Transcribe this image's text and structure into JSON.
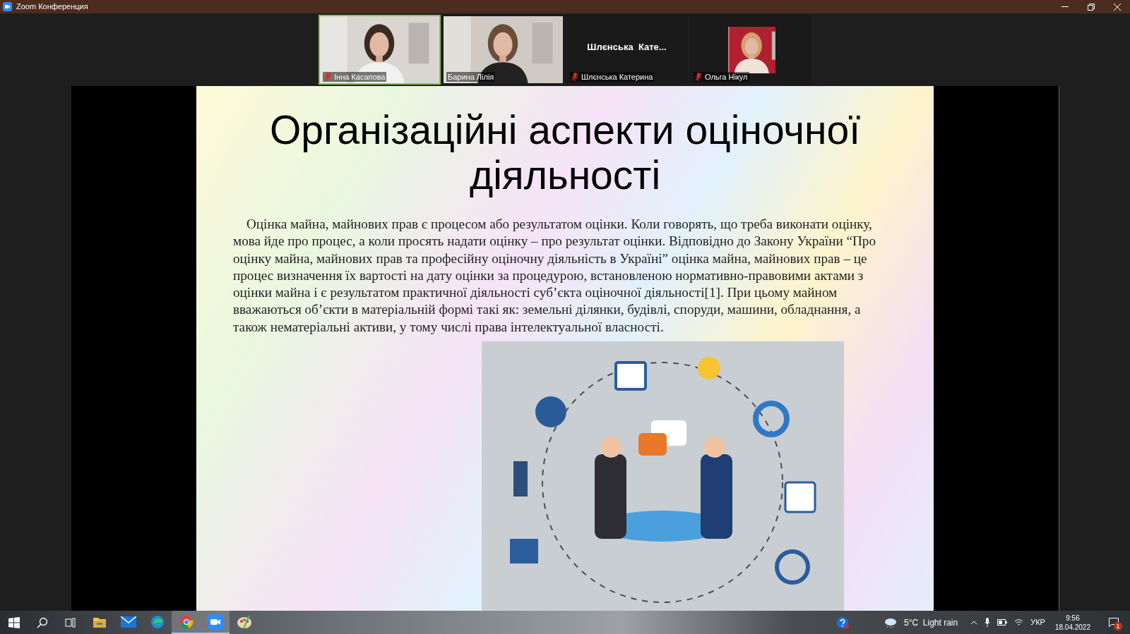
{
  "window": {
    "title": "Zoom Конференция"
  },
  "participants": [
    {
      "name": "Інна Касапова",
      "kind": "video",
      "muted": true,
      "selected": true
    },
    {
      "name": "Барина Лілія",
      "kind": "video",
      "muted": false,
      "selected": false
    },
    {
      "name": "Шлєнська Катерина",
      "kind": "name",
      "display": "Шлєнська  Кате...",
      "muted": true,
      "selected": false
    },
    {
      "name": "Ольга Нікул",
      "muted": true,
      "selected": false
    }
  ],
  "slide": {
    "title": "Організаційні аспекти оціночної діяльності",
    "body": "Оцінка майна, майнових прав є процесом або результатом оцінки. Коли говорять, що треба виконати оцінку, мова йде про процес, а коли просять надати оцінку – про результат оцінки. Відповідно до Закону України “Про оцінку майна, майнових прав та професійну оціночну діяльність в Україні” оцінка майна, майнових прав – це процес визначення їх вартості на дату оцінки за процедурою, встановленою нормативно-правовими актами з оцінки майна і є результатом практичної діяльності суб’єкта оціночної діяльності[1]. При цьому майном вважаються об’єкти в матеріальній формі такі як: земельні ділянки, будівлі, споруди, машини, обладнання, а також нематеріальні активи, у тому числі права інтелектуальної власності."
  },
  "taskbar": {
    "apps": [
      {
        "kind": "explorer",
        "selected": false
      },
      {
        "kind": "mail",
        "selected": false
      },
      {
        "kind": "edge",
        "selected": false
      },
      {
        "kind": "chrome",
        "selected": true
      },
      {
        "kind": "zoom",
        "selected": true
      },
      {
        "kind": "paint",
        "selected": false
      }
    ],
    "weather": "5°C  Light rain",
    "language": "УКР",
    "time": "9:56",
    "date": "18.04.2022",
    "notifications": "1"
  }
}
